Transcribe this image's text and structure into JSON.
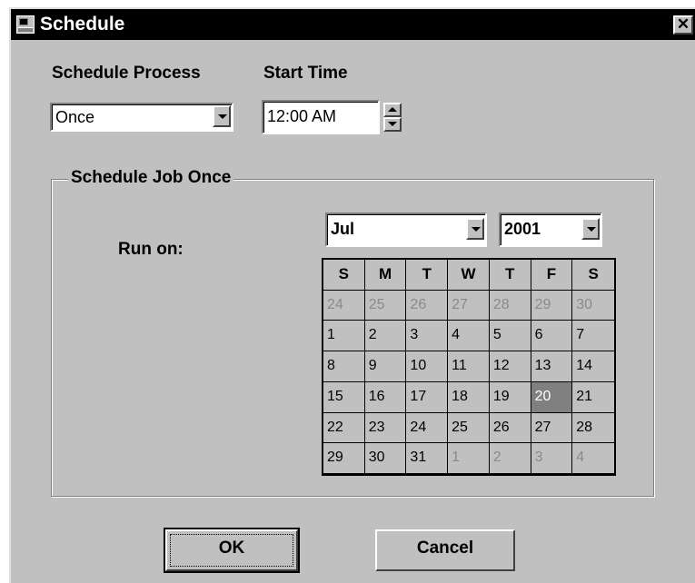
{
  "window": {
    "title": "Schedule"
  },
  "schedule_process": {
    "label": "Schedule Process",
    "value": "Once"
  },
  "start_time": {
    "label": "Start Time",
    "value": "12:00 AM"
  },
  "group": {
    "legend": "Schedule Job Once",
    "run_on_label": "Run on:",
    "month": "Jul",
    "year": "2001"
  },
  "calendar": {
    "weekday_headers": [
      "S",
      "M",
      "T",
      "W",
      "T",
      "F",
      "S"
    ],
    "days": [
      {
        "label": "24",
        "current": false
      },
      {
        "label": "25",
        "current": false
      },
      {
        "label": "26",
        "current": false
      },
      {
        "label": "27",
        "current": false
      },
      {
        "label": "28",
        "current": false
      },
      {
        "label": "29",
        "current": false
      },
      {
        "label": "30",
        "current": false
      },
      {
        "label": "1",
        "current": true
      },
      {
        "label": "2",
        "current": true
      },
      {
        "label": "3",
        "current": true
      },
      {
        "label": "4",
        "current": true
      },
      {
        "label": "5",
        "current": true
      },
      {
        "label": "6",
        "current": true
      },
      {
        "label": "7",
        "current": true
      },
      {
        "label": "8",
        "current": true
      },
      {
        "label": "9",
        "current": true
      },
      {
        "label": "10",
        "current": true
      },
      {
        "label": "11",
        "current": true
      },
      {
        "label": "12",
        "current": true
      },
      {
        "label": "13",
        "current": true
      },
      {
        "label": "14",
        "current": true
      },
      {
        "label": "15",
        "current": true
      },
      {
        "label": "16",
        "current": true
      },
      {
        "label": "17",
        "current": true
      },
      {
        "label": "18",
        "current": true
      },
      {
        "label": "19",
        "current": true
      },
      {
        "label": "20",
        "current": true,
        "selected": true
      },
      {
        "label": "21",
        "current": true
      },
      {
        "label": "22",
        "current": true
      },
      {
        "label": "23",
        "current": true
      },
      {
        "label": "24",
        "current": true
      },
      {
        "label": "25",
        "current": true
      },
      {
        "label": "26",
        "current": true
      },
      {
        "label": "27",
        "current": true
      },
      {
        "label": "28",
        "current": true
      },
      {
        "label": "29",
        "current": true
      },
      {
        "label": "30",
        "current": true
      },
      {
        "label": "31",
        "current": true
      },
      {
        "label": "1",
        "current": false
      },
      {
        "label": "2",
        "current": false
      },
      {
        "label": "3",
        "current": false
      },
      {
        "label": "4",
        "current": false
      }
    ]
  },
  "buttons": {
    "ok": "OK",
    "cancel": "Cancel"
  },
  "colors": {
    "face": "#c0c0c0",
    "selected_day": "#808080",
    "titlebar": "#000000"
  }
}
